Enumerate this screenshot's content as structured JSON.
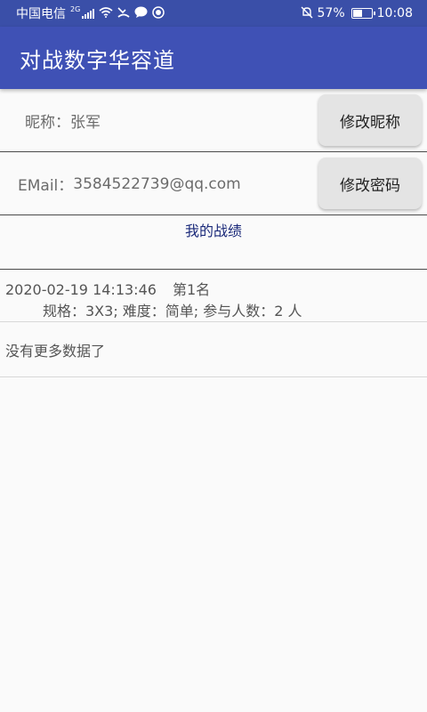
{
  "status_bar": {
    "carrier": "中国电信",
    "network_badge": "2G",
    "battery": "57%",
    "battery_level": 0.57,
    "time": "10:08",
    "icons": [
      "wifi-icon",
      "missed-call-icon",
      "message-icon",
      "app-notification-icon",
      "mute-icon",
      "battery-icon"
    ]
  },
  "app_bar": {
    "title": "对战数字华容道"
  },
  "profile": {
    "nickname_label": "昵称：",
    "nickname_value": "张军",
    "change_nickname_button": "修改昵称",
    "email_label": "EMail：",
    "email_value": "3584522739@qq.com",
    "change_password_button": "修改密码"
  },
  "records": {
    "title": "我的战绩",
    "items": [
      {
        "datetime": "2020-02-19 14:13:46",
        "rank": "第1名",
        "details": "规格：3X3; 难度：简单; 参与人数：2 人"
      }
    ],
    "no_more": "没有更多数据了"
  },
  "colors": {
    "status_bar": "#3a4fa8",
    "app_bar": "#3f51b5",
    "section_title": "#1b2a7a",
    "button_bg": "#e4e4e4"
  }
}
